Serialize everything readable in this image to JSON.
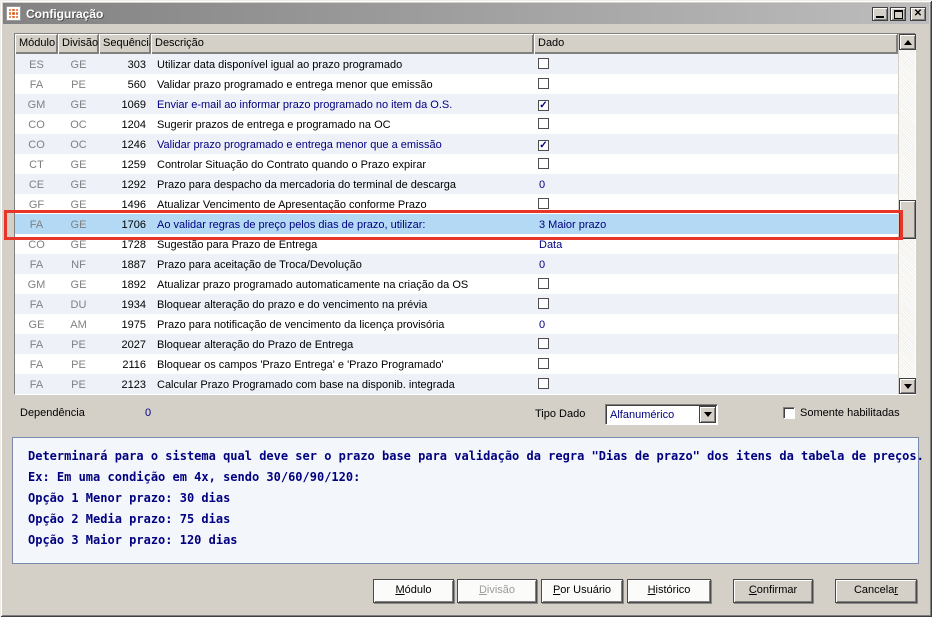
{
  "window": {
    "title": "Configuração",
    "controls": [
      "minimize",
      "maximize",
      "close"
    ]
  },
  "table": {
    "columns": [
      "Módulo",
      "Divisão",
      "Sequência",
      "Descrição",
      "Dado"
    ],
    "rows": [
      {
        "modulo": "ES",
        "divisao": "GE",
        "seq": "303",
        "desc": "Utilizar data disponível igual ao prazo programado",
        "dado": {
          "type": "checkbox",
          "checked": false
        }
      },
      {
        "modulo": "FA",
        "divisao": "PE",
        "seq": "560",
        "desc": "Validar prazo programado e entrega menor que emissão",
        "dado": {
          "type": "checkbox",
          "checked": false
        }
      },
      {
        "modulo": "GM",
        "divisao": "GE",
        "seq": "1069",
        "desc": "Enviar e-mail ao informar prazo programado no item da O.S.",
        "desc_navy": true,
        "dado": {
          "type": "checkbox",
          "checked": true
        }
      },
      {
        "modulo": "CO",
        "divisao": "OC",
        "seq": "1204",
        "desc": "Sugerir prazos de entrega e programado na OC",
        "dado": {
          "type": "checkbox",
          "checked": false
        }
      },
      {
        "modulo": "CO",
        "divisao": "OC",
        "seq": "1246",
        "desc": "Validar prazo programado e entrega menor que a emissão",
        "desc_navy": true,
        "dado": {
          "type": "checkbox",
          "checked": true
        }
      },
      {
        "modulo": "CT",
        "divisao": "GE",
        "seq": "1259",
        "desc": "Controlar Situação do Contrato quando o Prazo expirar",
        "dado": {
          "type": "checkbox",
          "checked": false
        }
      },
      {
        "modulo": "CE",
        "divisao": "GE",
        "seq": "1292",
        "desc": "Prazo para despacho da mercadoria do terminal de descarga",
        "dado": {
          "type": "text",
          "value": "0"
        }
      },
      {
        "modulo": "GF",
        "divisao": "GE",
        "seq": "1496",
        "desc": "Atualizar Vencimento de Apresentação conforme Prazo",
        "dado": {
          "type": "checkbox",
          "checked": false
        }
      },
      {
        "modulo": "FA",
        "divisao": "GE",
        "seq": "1706",
        "desc": "Ao validar regras de preço pelos dias de prazo, utilizar:",
        "desc_navy": true,
        "selected": true,
        "dado": {
          "type": "text",
          "value": "3 Maior prazo"
        }
      },
      {
        "modulo": "CO",
        "divisao": "GE",
        "seq": "1728",
        "desc": "Sugestão para Prazo de Entrega",
        "dado": {
          "type": "text",
          "value": "Data"
        }
      },
      {
        "modulo": "FA",
        "divisao": "NF",
        "seq": "1887",
        "desc": "Prazo para aceitação de Troca/Devolução",
        "dado": {
          "type": "text",
          "value": "0"
        }
      },
      {
        "modulo": "GM",
        "divisao": "GE",
        "seq": "1892",
        "desc": "Atualizar prazo programado automaticamente na criação da OS",
        "dado": {
          "type": "checkbox",
          "checked": false
        }
      },
      {
        "modulo": "FA",
        "divisao": "DU",
        "seq": "1934",
        "desc": "Bloquear alteração do prazo e do vencimento na prévia",
        "dado": {
          "type": "checkbox",
          "checked": false
        }
      },
      {
        "modulo": "GE",
        "divisao": "AM",
        "seq": "1975",
        "desc": "Prazo para notificação de vencimento da licença provisória",
        "dado": {
          "type": "text",
          "value": "0"
        }
      },
      {
        "modulo": "FA",
        "divisao": "PE",
        "seq": "2027",
        "desc": "Bloquear alteração do Prazo de Entrega",
        "dado": {
          "type": "checkbox",
          "checked": false
        }
      },
      {
        "modulo": "FA",
        "divisao": "PE",
        "seq": "2116",
        "desc": "Bloquear os campos 'Prazo Entrega' e 'Prazo Programado'",
        "dado": {
          "type": "checkbox",
          "checked": false
        }
      },
      {
        "modulo": "FA",
        "divisao": "PE",
        "seq": "2123",
        "desc": "Calcular Prazo Programado com base na disponib. integrada",
        "dado": {
          "type": "checkbox",
          "checked": false
        }
      }
    ]
  },
  "footer": {
    "dependencia_label": "Dependência",
    "dependencia_value": "0",
    "tipo_dado_label": "Tipo Dado",
    "tipo_dado_value": "Alfanumérico",
    "somente_habilitadas_label": "Somente habilitadas",
    "somente_habilitadas_checked": false
  },
  "description_box": {
    "lines": [
      "Determinará para o sistema qual deve ser o prazo base para validação da regra \"Dias de prazo\" dos itens da tabela de preços.",
      "Ex: Em uma condição em 4x, sendo 30/60/90/120:",
      "Opção 1 Menor prazo: 30 dias",
      "Opção 2 Media prazo: 75 dias",
      "Opção 3 Maior prazo: 120 dias"
    ]
  },
  "buttons": [
    {
      "label": "Módulo",
      "underline_index": 0,
      "variant": "light",
      "disabled": false
    },
    {
      "label": "Divisão",
      "underline_index": 0,
      "variant": "light",
      "disabled": true
    },
    {
      "label": "Por Usuário",
      "underline_index": 0,
      "variant": "light",
      "disabled": false
    },
    {
      "label": "Histórico",
      "underline_index": 0,
      "variant": "light",
      "disabled": false
    },
    {
      "label": "Confirmar",
      "underline_index": 0,
      "variant": "face",
      "disabled": false
    },
    {
      "label": "Cancelar",
      "underline_index": 7,
      "variant": "face",
      "disabled": false
    }
  ],
  "colors": {
    "selected_row": "#b3d9f5",
    "highlight_border": "#e8352a",
    "navy_text": "#000080",
    "dialog_face": "#d4d0c8"
  }
}
